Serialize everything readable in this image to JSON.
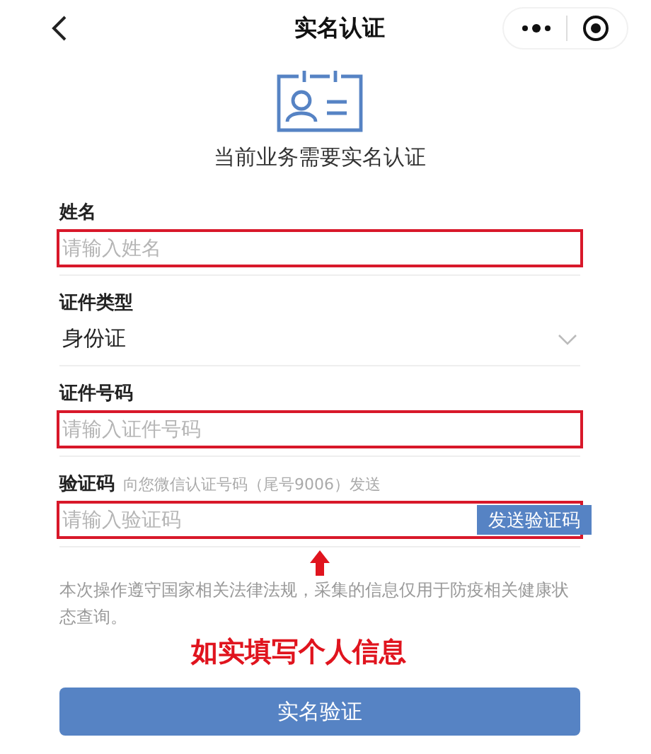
{
  "nav": {
    "title": "实名认证"
  },
  "header": {
    "subtitle": "当前业务需要实名认证"
  },
  "fields": [
    {
      "kind": "input",
      "label": "姓名",
      "placeholder": "请输入姓名",
      "highlighted": true
    },
    {
      "kind": "select",
      "label": "证件类型",
      "value": "身份证"
    },
    {
      "kind": "input",
      "label": "证件号码",
      "placeholder": "请输入证件号码",
      "highlighted": true
    },
    {
      "kind": "code",
      "label": "验证码",
      "hint": "向您微信认证号码（尾号9006）发送",
      "placeholder": "请输入验证码",
      "button": "发送验证码",
      "highlighted": true
    }
  ],
  "notice": "本次操作遵守国家相关法律法规，采集的信息仅用于防疫相关健康状态查询。",
  "annotation": {
    "text": "如实填写个人信息"
  },
  "submit": "实名验证"
}
